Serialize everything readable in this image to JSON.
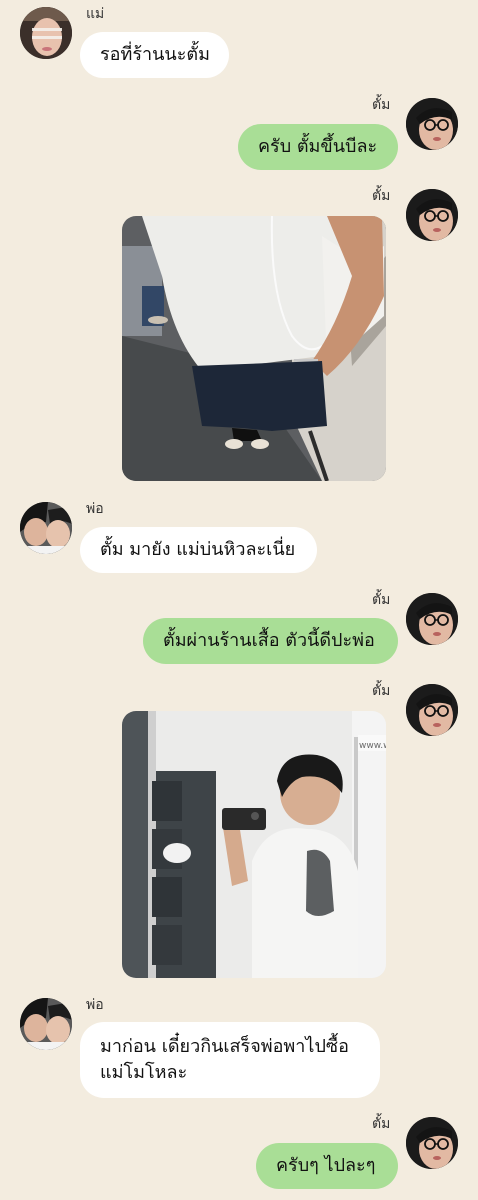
{
  "messages": [
    {
      "sender": "แม่",
      "text": "รอที่ร้านนะตั้ม"
    },
    {
      "sender": "ตั้ม",
      "text": "ครับ ตั้มขึ้นบีละ"
    },
    {
      "sender": "ตั้ม"
    },
    {
      "sender": "พ่อ",
      "text": "ตั้ม มายัง แม่บ่นหิวละเนี่ย"
    },
    {
      "sender": "ตั้ม",
      "text": "ตั้มผ่านร้านเสื้อ ตัวนี้ดีปะพ่อ"
    },
    {
      "sender": "ตั้ม",
      "photo_sign": "www.w"
    },
    {
      "sender": "พ่อ",
      "text_line1": "มาก่อน เดี๋ยวกินเสร็จพ่อพาไปซื้อ",
      "text_line2": "แม่โมโหละ"
    },
    {
      "sender": "ตั้ม",
      "text": "ครับๆ ไปละๆ"
    }
  ]
}
